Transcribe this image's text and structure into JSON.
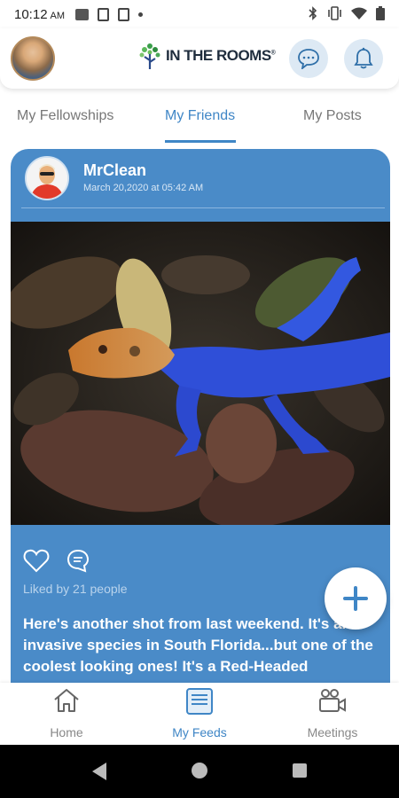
{
  "status_bar": {
    "time": "10:12",
    "ampm": "AM"
  },
  "header": {
    "logo_text": "IN THE ROOMS",
    "logo_mark": "®"
  },
  "tabs": [
    {
      "label": "My Fellowships"
    },
    {
      "label": "My Friends"
    },
    {
      "label": "My Posts"
    }
  ],
  "active_tab": "My Friends",
  "post": {
    "author": "MrClean",
    "date": "March 20,2020 at 05:42 AM",
    "likes_text": "Liked by 21 people",
    "caption": "Here's another shot from last weekend. It's an invasive species in South Florida...but one of the coolest looking ones! It's a Red-Headed"
  },
  "bottom_nav": [
    {
      "label": "Home",
      "icon": "home-icon"
    },
    {
      "label": "My Feeds",
      "icon": "feeds-icon"
    },
    {
      "label": "Meetings",
      "icon": "video-meeting-icon"
    }
  ],
  "colors": {
    "accent": "#3f86c6",
    "card": "#4a8bc8"
  }
}
